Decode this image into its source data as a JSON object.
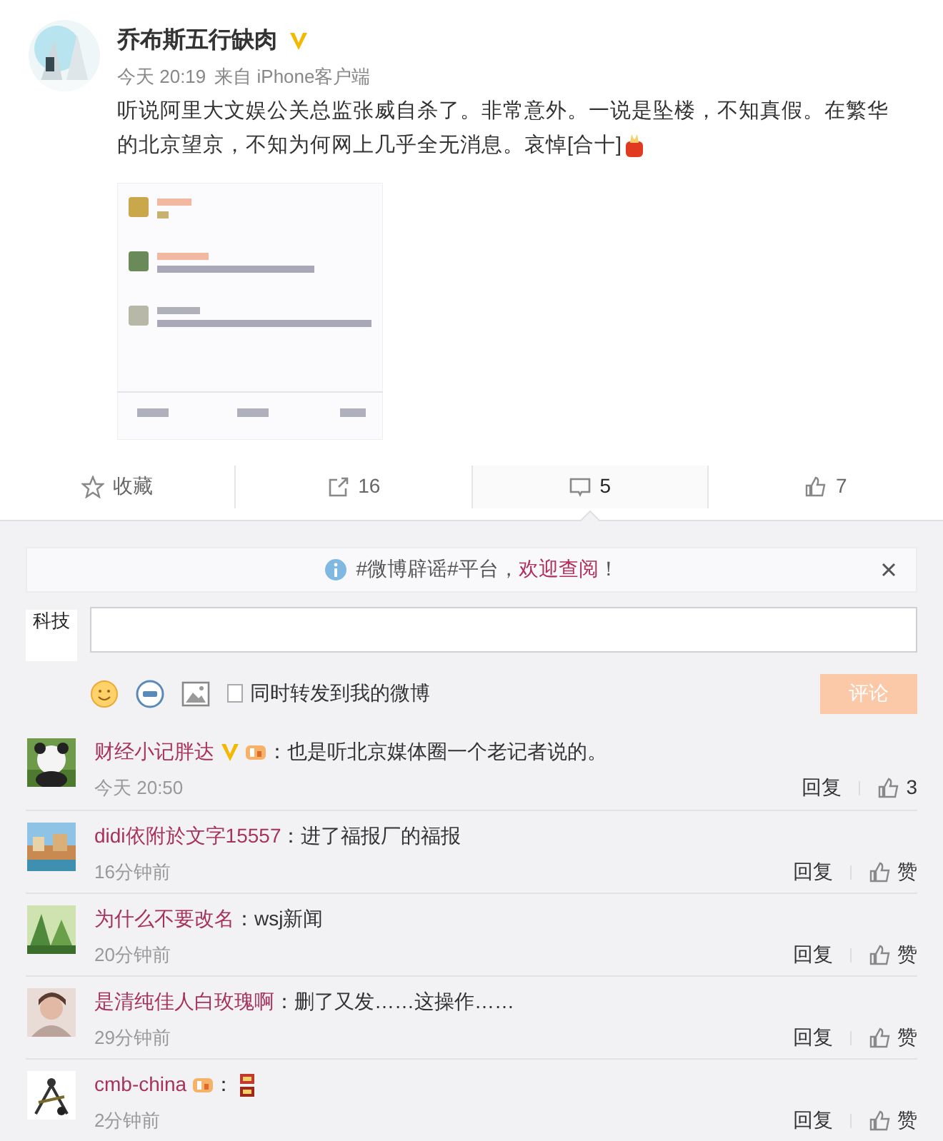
{
  "post": {
    "author": "乔布斯五行缺肉",
    "verified": true,
    "time": "今天 20:19",
    "source": "来自 iPhone客户端",
    "text": "听说阿里大文娱公关总监张威自杀了。非常意外。一说是坠楼，不知真假。在繁华的北京望京，不知为何网上几乎全无消息。哀悼[合十]"
  },
  "actions": [
    {
      "kind": "favorite",
      "label": "收藏",
      "selected": false
    },
    {
      "kind": "repost",
      "label": "16",
      "selected": false
    },
    {
      "kind": "comment",
      "label": "5",
      "selected": true
    },
    {
      "kind": "like",
      "label": "7",
      "selected": false
    }
  ],
  "notice": {
    "prefix": "#微博辟谣#平台，",
    "link": "欢迎查阅",
    "suffix": "！"
  },
  "composer": {
    "avatar_text": "科技",
    "repost_label": "同时转发到我的微博",
    "repost_checked": false,
    "submit": "评论",
    "submit_disabled": true
  },
  "comments": [
    {
      "name": "财经小记胖达",
      "verified": true,
      "level_badge": true,
      "text": "：也是听北京媒体圈一个老记者说的。",
      "emoji": false,
      "time": "今天 20:50",
      "reply": "回复",
      "likes": "3"
    },
    {
      "name": "didi依附於文字15557",
      "verified": false,
      "level_badge": false,
      "text": "：进了福报厂的福报",
      "emoji": false,
      "time": "16分钟前",
      "reply": "回复",
      "likes": "赞"
    },
    {
      "name": "为什么不要改名",
      "verified": false,
      "level_badge": false,
      "text": "：wsj新闻",
      "emoji": false,
      "time": "20分钟前",
      "reply": "回复",
      "likes": "赞"
    },
    {
      "name": "是清纯佳人白玫瑰啊",
      "verified": false,
      "level_badge": false,
      "text": "：删了又发……这操作……",
      "emoji": false,
      "time": "29分钟前",
      "reply": "回复",
      "likes": "赞"
    },
    {
      "name": "cmb-china",
      "verified": false,
      "level_badge": true,
      "text": "：",
      "emoji": true,
      "time": "2分钟前",
      "reply": "回复",
      "likes": "赞"
    }
  ]
}
